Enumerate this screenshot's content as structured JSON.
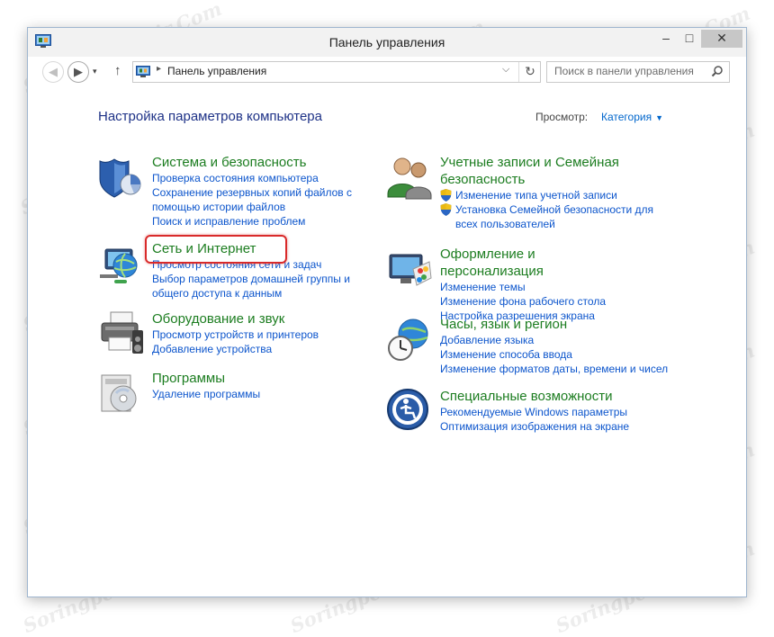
{
  "window": {
    "title": "Панель управления",
    "min_glyph": "–",
    "max_glyph": "□",
    "close_glyph": "✕"
  },
  "address": {
    "back_glyph": "◀",
    "forward_glyph": "▶",
    "recent_glyph": "▾",
    "up_glyph": "↑",
    "separator": "▸",
    "location": "Панель управления",
    "dropdown_glyph": "⌵",
    "refresh_glyph": "↻",
    "search_placeholder": "Поиск в панели управления"
  },
  "header": {
    "title": "Настройка параметров компьютера",
    "view_label": "Просмотр:",
    "view_value": "Категория",
    "view_arrow": "▼"
  },
  "categories": [
    {
      "title": "Система и безопасность",
      "icon": "shield-chart-icon",
      "links": [
        "Проверка состояния компьютера",
        "Сохранение резервных копий файлов с",
        "помощью истории файлов",
        "Поиск и исправление проблем"
      ]
    },
    {
      "title": "Сеть и Интернет",
      "icon": "globe-network-icon",
      "links": [
        "Просмотр состояния сети и задач",
        "Выбор параметров домашней группы и",
        "общего доступа к данным"
      ]
    },
    {
      "title": "Оборудование и звук",
      "icon": "printer-icon",
      "links": [
        "Просмотр устройств и принтеров",
        "Добавление устройства"
      ]
    },
    {
      "title": "Программы",
      "icon": "programs-disc-icon",
      "links": [
        "Удаление программы"
      ]
    },
    {
      "title_line1": "Учетные записи и Семейная",
      "title_line2": "безопасность",
      "icon": "users-icon",
      "links": [
        "Изменение типа учетной записи",
        "Установка Семейной безопасности для",
        "всех пользователей"
      ]
    },
    {
      "title": "Оформление и персонализация",
      "icon": "monitor-palette-icon",
      "links": [
        "Изменение темы",
        "Изменение фона рабочего стола",
        "Настройка разрешения экрана"
      ]
    },
    {
      "title": "Часы, язык и регион",
      "icon": "clock-globe-icon",
      "links": [
        "Добавление языка",
        "Изменение способа ввода",
        "Изменение форматов даты, времени и чисел"
      ]
    },
    {
      "title": "Специальные возможности",
      "icon": "accessibility-icon",
      "links": [
        "Рекомендуемые Windows параметры",
        "Оптимизация изображения на экране"
      ]
    }
  ],
  "watermark": "Soringpcrepair.Com",
  "colors": {
    "category_title": "#1c7d20",
    "link": "#0c55cc",
    "heading": "#1e3287",
    "highlight": "#d92a2a"
  }
}
